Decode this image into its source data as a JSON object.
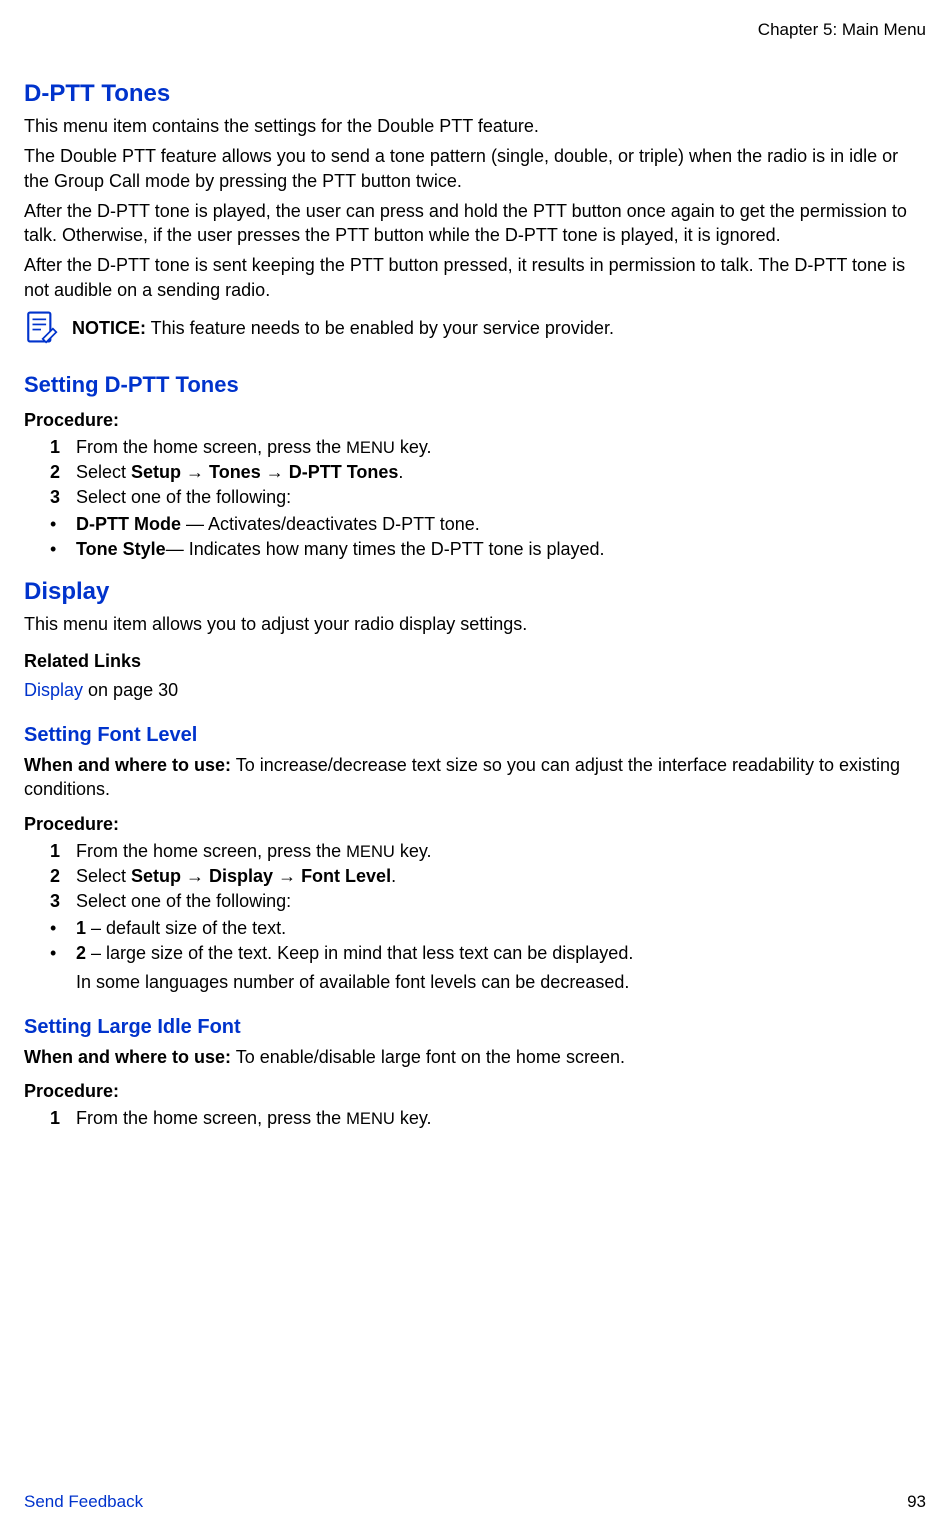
{
  "header": {
    "chapter": "Chapter 5: Main Menu"
  },
  "dptt": {
    "title": "D-PTT Tones",
    "p1": "This menu item contains the settings for the Double PTT feature.",
    "p2": "The Double PTT feature allows you to send a tone pattern (single, double, or triple) when the radio is in idle or the Group Call mode by pressing the PTT button twice.",
    "p3": "After the D-PTT tone is played, the user can press and hold the PTT button once again to get the permission to talk. Otherwise, if the user presses the PTT button while the D-PTT tone is played, it is ignored.",
    "p4": "After the D-PTT tone is sent keeping the PTT button pressed, it results in permission to talk. The D-PTT tone is not audible on a sending radio.",
    "notice_label": "NOTICE:",
    "notice_text": " This feature needs to be enabled by your service provider."
  },
  "setting_dptt": {
    "title": "Setting D-PTT Tones",
    "procedure_label": "Procedure:",
    "steps": {
      "s1_pre": "From the home screen, press the ",
      "s1_menu": "MENU",
      "s1_post": " key.",
      "s2_pre": "Select ",
      "s2_path": "Setup → Tones → D-PTT Tones",
      "s2_post": ".",
      "s3": "Select one of the following:"
    },
    "bullets": {
      "b1_bold": "D-PTT Mode",
      "b1_rest": " — Activates/deactivates D-PTT tone.",
      "b2_bold": "Tone Style",
      "b2_rest": "— Indicates how many times the D-PTT tone is played."
    }
  },
  "display": {
    "title": "Display",
    "p1": "This menu item allows you to adjust your radio display settings.",
    "related_label": "Related Links",
    "related_link": "Display",
    "related_rest": " on page 30"
  },
  "font_level": {
    "title": "Setting Font Level",
    "when_label": "When and where to use:",
    "when_text": " To increase/decrease text size so you can adjust the interface readability to existing conditions.",
    "procedure_label": "Procedure:",
    "steps": {
      "s1_pre": "From the home screen, press the ",
      "s1_menu": "MENU",
      "s1_post": " key.",
      "s2_pre": "Select ",
      "s2_path": "Setup → Display → Font Level",
      "s2_post": ".",
      "s3": "Select one of the following:"
    },
    "bullets": {
      "b1_bold": "1",
      "b1_rest": " – default size of the text.",
      "b2_bold": "2",
      "b2_rest": " – large size of the text. Keep in mind that less text can be displayed."
    },
    "note": "In some languages number of available font levels can be decreased."
  },
  "large_idle": {
    "title": "Setting Large Idle Font",
    "when_label": "When and where to use:",
    "when_text": " To enable/disable large font on the home screen.",
    "procedure_label": "Procedure:",
    "steps": {
      "s1_pre": "From the home screen, press the ",
      "s1_menu": "MENU",
      "s1_post": " key."
    }
  },
  "footer": {
    "feedback": "Send Feedback",
    "page": "93"
  }
}
